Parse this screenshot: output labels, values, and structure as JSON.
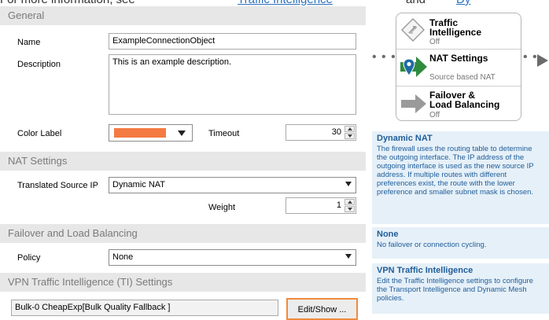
{
  "topline": {
    "text": "For more information, see",
    "link1": "Traffic Intelligence",
    "mid": "and",
    "link2": "Dy"
  },
  "sections": {
    "general": "General",
    "nat": "NAT Settings",
    "failover": "Failover and Load Balancing",
    "vpn": "VPN Traffic Intelligence (TI) Settings"
  },
  "general": {
    "name_label": "Name",
    "name_value": "ExampleConnectionObject",
    "description_label": "Description",
    "description_value": "This is an example description.",
    "color_label": "Color Label",
    "color_value": "#f47a43",
    "timeout_label": "Timeout",
    "timeout_value": "30"
  },
  "nat": {
    "translated_label": "Translated Source IP",
    "translated_value": "Dynamic NAT",
    "weight_label": "Weight",
    "weight_value": "1"
  },
  "failover": {
    "policy_label": "Policy",
    "policy_value": "None"
  },
  "vpn": {
    "ti_value": "Bulk-0 CheapExp[Bulk Quality Fallback ]",
    "edit_button": "Edit/Show ..."
  },
  "diagram": {
    "rows": [
      {
        "title": "Traffic Intelligence",
        "title_l1": "Traffic",
        "title_l2": "Intelligence",
        "sub": "Off",
        "icon": "traffic-intelligence-icon"
      },
      {
        "title": "NAT Settings",
        "sub": "Source based NAT",
        "icon": "nat-settings-icon"
      },
      {
        "title": "Failover & Load Balancing",
        "title_l1": "Failover &",
        "title_l2": "Load Balancing",
        "sub": "Off",
        "icon": "failover-arrow-icon"
      }
    ],
    "colors": {
      "nat_arrow": "#2e8b3e",
      "pin": "#1f6aa5",
      "gray": "#9a9a9a"
    }
  },
  "info": {
    "dynamic_nat": {
      "title": "Dynamic NAT",
      "text": "The firewall uses the routing table to determine the outgoing interface. The IP address of the outgoing interface is used as the new source IP address. If multiple routes with different preferences exist, the route with the lower preference and smaller subnet mask is chosen."
    },
    "none": {
      "title": "None",
      "text": "No failover or connection cycling."
    },
    "vpn_ti": {
      "title": "VPN Traffic Intelligence",
      "text": "Edit the Traffic Intelligence settings to configure the Transport Intelligence and Dynamic Mesh policies."
    }
  }
}
